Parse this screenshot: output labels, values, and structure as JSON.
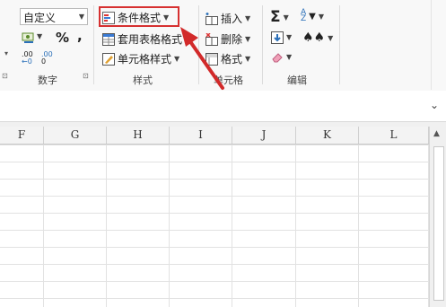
{
  "number": {
    "format_value": "自定义",
    "percent_label": "%",
    "comma_label": ",",
    "inc_decimal_label": ".00",
    "dec_decimal_label": "0",
    "group_label": "数字"
  },
  "styles": {
    "conditional_formatting_label": "条件格式",
    "format_as_table_label": "套用表格格式",
    "cell_styles_label": "单元格样式",
    "group_label": "样式"
  },
  "cells": {
    "insert_label": "插入",
    "delete_label": "删除",
    "format_label": "格式",
    "group_label": "单元格"
  },
  "editing": {
    "group_label": "编辑"
  },
  "columns": [
    "F",
    "G",
    "H",
    "I",
    "J",
    "K",
    "L"
  ],
  "colors": {
    "highlight": "#d63030",
    "arrow": "#d22a2a",
    "ribbon_bg": "#f8f8f8",
    "grid_line": "#e2e2e2"
  }
}
